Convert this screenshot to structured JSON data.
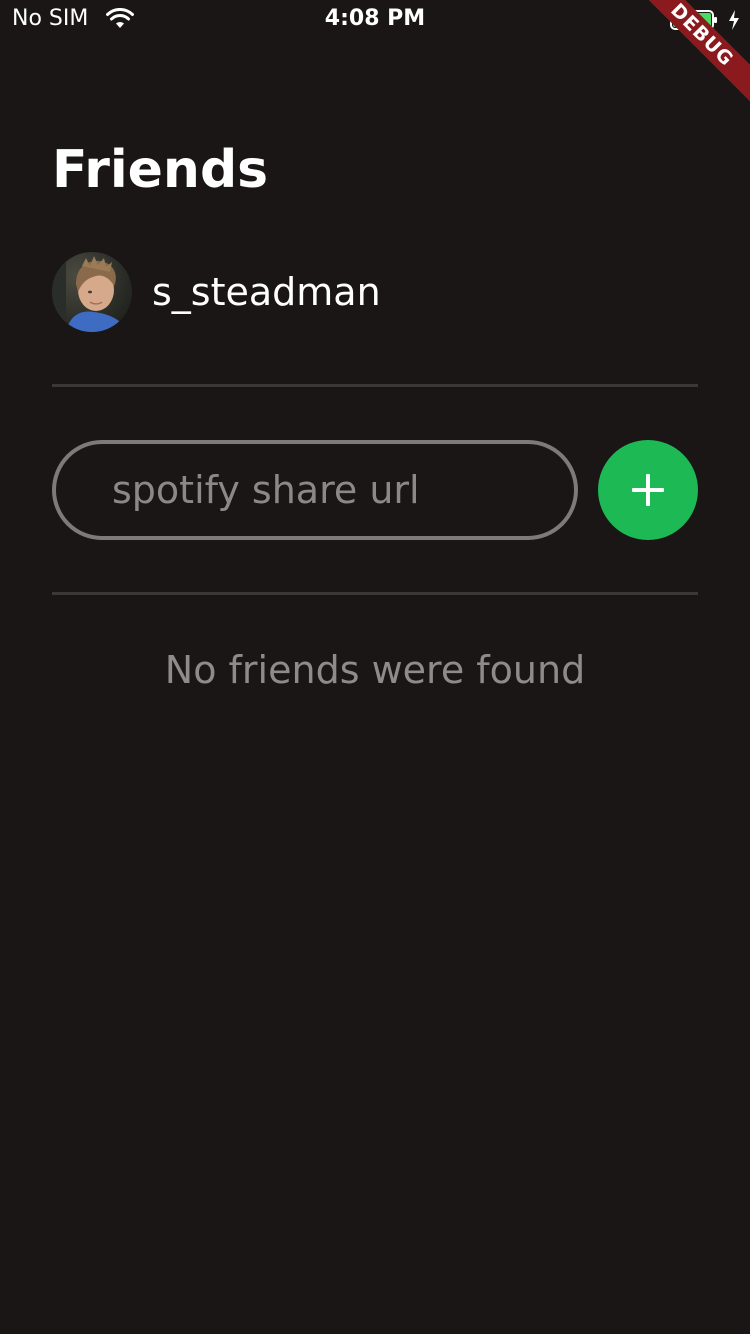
{
  "status_bar": {
    "carrier": "No SIM",
    "time": "4:08 PM",
    "wifi_icon": "wifi-icon",
    "battery_icon": "battery-icon",
    "battery_color": "#4cd964",
    "charging_icon": "bolt-icon"
  },
  "debug_banner": {
    "label": "DEBUG",
    "color": "#8a1a1d"
  },
  "header": {
    "title": "Friends"
  },
  "profile": {
    "username": "s_steadman",
    "avatar_icon": "user-avatar"
  },
  "add_friend": {
    "placeholder": "spotify share url",
    "value": "",
    "button_icon": "plus-icon",
    "button_color": "#1db954"
  },
  "friends": {
    "empty_message": "No friends were found",
    "items": []
  },
  "theme": {
    "background": "#1a1616",
    "divider": "#3b3737",
    "muted_text": "#8f8b8b"
  }
}
